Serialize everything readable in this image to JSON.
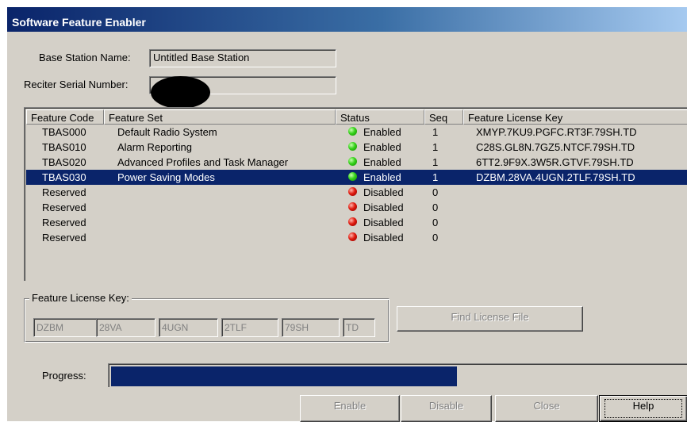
{
  "window": {
    "title": "Software Feature Enabler"
  },
  "base_station": {
    "label": "Base Station Name:",
    "value": "Untitled Base Station"
  },
  "reciter": {
    "label": "Reciter Serial Number:",
    "value": ""
  },
  "table": {
    "columns": [
      "Feature Code",
      "Feature Set",
      "Status",
      "Seq",
      "Feature License Key"
    ],
    "rows": [
      {
        "code": "TBAS000",
        "set": "Default Radio System",
        "status": "Enabled",
        "status_color": "green",
        "seq": "1",
        "key": "XMYP.7KU9.PGFC.RT3F.79SH.TD"
      },
      {
        "code": "TBAS010",
        "set": "Alarm Reporting",
        "status": "Enabled",
        "status_color": "green",
        "seq": "1",
        "key": "C28S.GL8N.7GZ5.NTCF.79SH.TD"
      },
      {
        "code": "TBAS020",
        "set": "Advanced Profiles and Task Manager",
        "status": "Enabled",
        "status_color": "green",
        "seq": "1",
        "key": "6TT2.9F9X.3W5R.GTVF.79SH.TD"
      },
      {
        "code": "TBAS030",
        "set": "Power Saving Modes",
        "status": "Enabled",
        "status_color": "green",
        "seq": "1",
        "key": "DZBM.28VA.4UGN.2TLF.79SH.TD",
        "selected": true
      },
      {
        "code": "Reserved",
        "set": "",
        "status": "Disabled",
        "status_color": "red",
        "seq": "0",
        "key": ""
      },
      {
        "code": "Reserved",
        "set": "",
        "status": "Disabled",
        "status_color": "red",
        "seq": "0",
        "key": ""
      },
      {
        "code": "Reserved",
        "set": "",
        "status": "Disabled",
        "status_color": "red",
        "seq": "0",
        "key": ""
      },
      {
        "code": "Reserved",
        "set": "",
        "status": "Disabled",
        "status_color": "red",
        "seq": "0",
        "key": ""
      }
    ]
  },
  "license_key": {
    "legend": "Feature License Key:",
    "parts": [
      "DZBM",
      "28VA",
      "4UGN",
      "2TLF",
      "79SH",
      "TD"
    ],
    "find_button": "Find License File"
  },
  "progress": {
    "label": "Progress:",
    "fraction": 0.594
  },
  "buttons": {
    "enable": "Enable",
    "disable": "Disable",
    "close": "Close",
    "help": "Help"
  },
  "colors": {
    "selection": "#0a246a",
    "face": "#d4d0c8",
    "enabled": "#35d21a",
    "disabled": "#e01a0e"
  }
}
